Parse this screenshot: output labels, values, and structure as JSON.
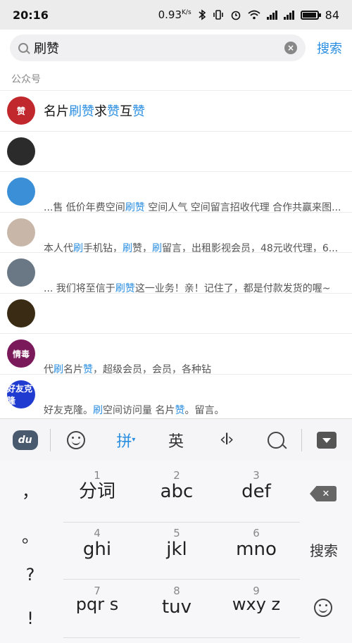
{
  "status_bar": {
    "time": "20:16",
    "speed": "0.93",
    "speed_unit": "K/s",
    "battery": "84"
  },
  "search": {
    "query": "刷赞",
    "button": "搜索"
  },
  "section": {
    "label": "公众号"
  },
  "results": [
    {
      "title_parts": [
        "名片",
        "刷赞",
        "求",
        "赞",
        "互",
        "赞"
      ],
      "desc_parts": []
    },
    {
      "title_parts": [],
      "desc_parts": []
    },
    {
      "title_parts": [],
      "desc_parts": [
        "...售 低价年费空间",
        "刷赞",
        " 空间人气 空间留言招收代理 合作共赢来图..."
      ]
    },
    {
      "title_parts": [],
      "desc_parts": [
        " 本人代",
        "刷",
        "手机钻，",
        "刷",
        "赞，",
        "刷",
        "留言，出租影视会员，48元收代理，6..."
      ]
    },
    {
      "title_parts": [],
      "desc_parts": [
        "... 我们将至信于",
        "刷赞",
        "这一业务！亲！记住了，都是付款发货的喔~"
      ]
    },
    {
      "title_parts": [],
      "desc_parts": []
    },
    {
      "title_parts": [],
      "desc_parts": [
        "代",
        "刷",
        "名片",
        "赞",
        "，超级会员，会员，各种钻"
      ]
    },
    {
      "title_parts": [],
      "desc_parts": [
        "好友克隆。",
        "刷",
        "空间访问量 名片",
        "赞",
        "。留言。"
      ]
    }
  ],
  "avatars": [
    {
      "text": "赞",
      "color": "#c0282d"
    },
    {
      "text": "",
      "color": "#2b2b2b"
    },
    {
      "text": "",
      "color": "#3b8fd6"
    },
    {
      "text": "",
      "color": "#c8b7a8"
    },
    {
      "text": "",
      "color": "#6a7785"
    },
    {
      "text": "",
      "color": "#3a2c14"
    },
    {
      "text": "情毒",
      "color": "#7a1a5a"
    },
    {
      "text": "好友克隆",
      "color": "#1f3bd0"
    }
  ],
  "avatar_icons": [
    "avatar-red-like",
    "avatar-dark-portrait",
    "avatar-blue-design",
    "avatar-floral",
    "avatar-girl",
    "avatar-gold-badge",
    "avatar-purple-text",
    "avatar-blue-text"
  ],
  "keyboard_toolbar": {
    "pinyin": "拼",
    "english": "英"
  },
  "keyboard": {
    "punct": [
      "，",
      "。",
      "?",
      "!"
    ],
    "keys": [
      {
        "num": "1",
        "label": "分词"
      },
      {
        "num": "2",
        "label": "abc"
      },
      {
        "num": "3",
        "label": "def"
      },
      {
        "num": "4",
        "label": "ghi"
      },
      {
        "num": "5",
        "label": "jkl"
      },
      {
        "num": "6",
        "label": "mno"
      },
      {
        "num": "7",
        "label": "pqr s"
      },
      {
        "num": "8",
        "label": "tuv"
      },
      {
        "num": "9",
        "label": "wxy z"
      }
    ],
    "search_key": "搜索"
  },
  "colors": {
    "accent": "#2a8ee0",
    "text": "#222222",
    "muted": "#888888"
  }
}
